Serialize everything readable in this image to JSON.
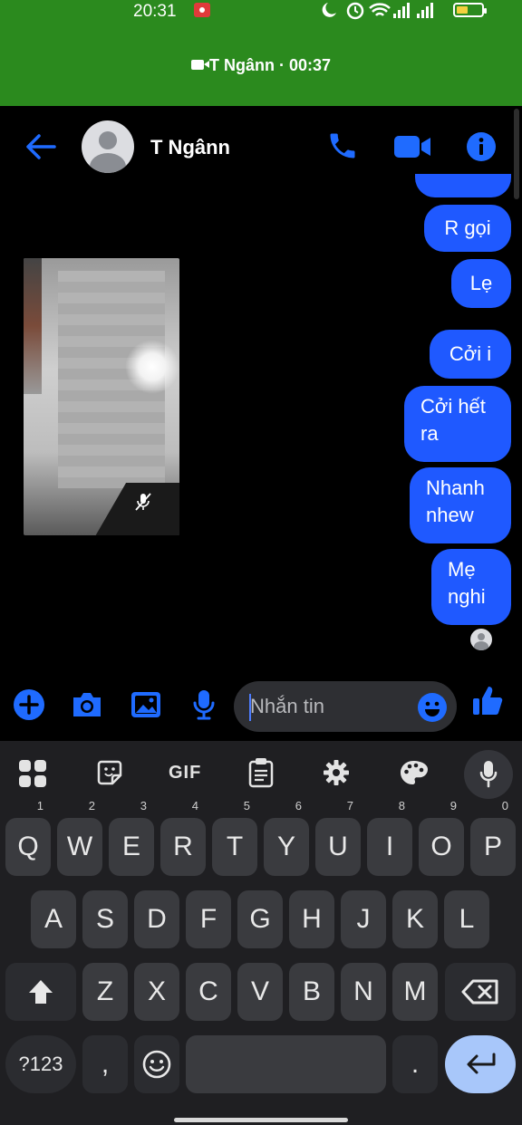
{
  "status_bar": {
    "time": "20:31"
  },
  "call_banner": {
    "text": "T Ngânn · 00:37"
  },
  "header": {
    "contact_name": "T Ngânn"
  },
  "messages": [
    {
      "text": "R gọi"
    },
    {
      "text": "Lẹ"
    },
    {
      "text": "Cởi i"
    },
    {
      "text_line1": "Cởi hết",
      "text_line2": "ra"
    },
    {
      "text_line1": "Nhanh",
      "text_line2": "nhew"
    },
    {
      "text_line1": "Mẹ",
      "text_line2": "nghi"
    }
  ],
  "composer": {
    "placeholder": "Nhắn tin"
  },
  "keyboard": {
    "gif_label": "GIF",
    "row1": [
      {
        "key": "Q",
        "hint": "1"
      },
      {
        "key": "W",
        "hint": "2"
      },
      {
        "key": "E",
        "hint": "3"
      },
      {
        "key": "R",
        "hint": "4"
      },
      {
        "key": "T",
        "hint": "5"
      },
      {
        "key": "Y",
        "hint": "6"
      },
      {
        "key": "U",
        "hint": "7"
      },
      {
        "key": "I",
        "hint": "8"
      },
      {
        "key": "O",
        "hint": "9"
      },
      {
        "key": "P",
        "hint": "0"
      }
    ],
    "row2": [
      "A",
      "S",
      "D",
      "F",
      "G",
      "H",
      "J",
      "K",
      "L"
    ],
    "row3": [
      "Z",
      "X",
      "C",
      "V",
      "B",
      "N",
      "M"
    ],
    "symbols_label": "?123",
    "comma": ",",
    "period": "."
  },
  "colors": {
    "banner": "#2b8a1e",
    "bubble": "#1f59ff",
    "accent_icon": "#1f6bff",
    "keyboard_bg": "#1f1f22",
    "key": "#3a3b3f",
    "enter_key": "#a8c7fa"
  },
  "icons": [
    "back-arrow-icon",
    "phone-icon",
    "video-call-icon",
    "info-icon",
    "plus-icon",
    "camera-icon",
    "image-icon",
    "mic-icon",
    "emoji-icon",
    "thumbs-up-icon",
    "apps-grid-icon",
    "sticker-icon",
    "clipboard-icon",
    "gear-icon",
    "palette-icon",
    "shift-icon",
    "backspace-icon",
    "enter-icon"
  ]
}
